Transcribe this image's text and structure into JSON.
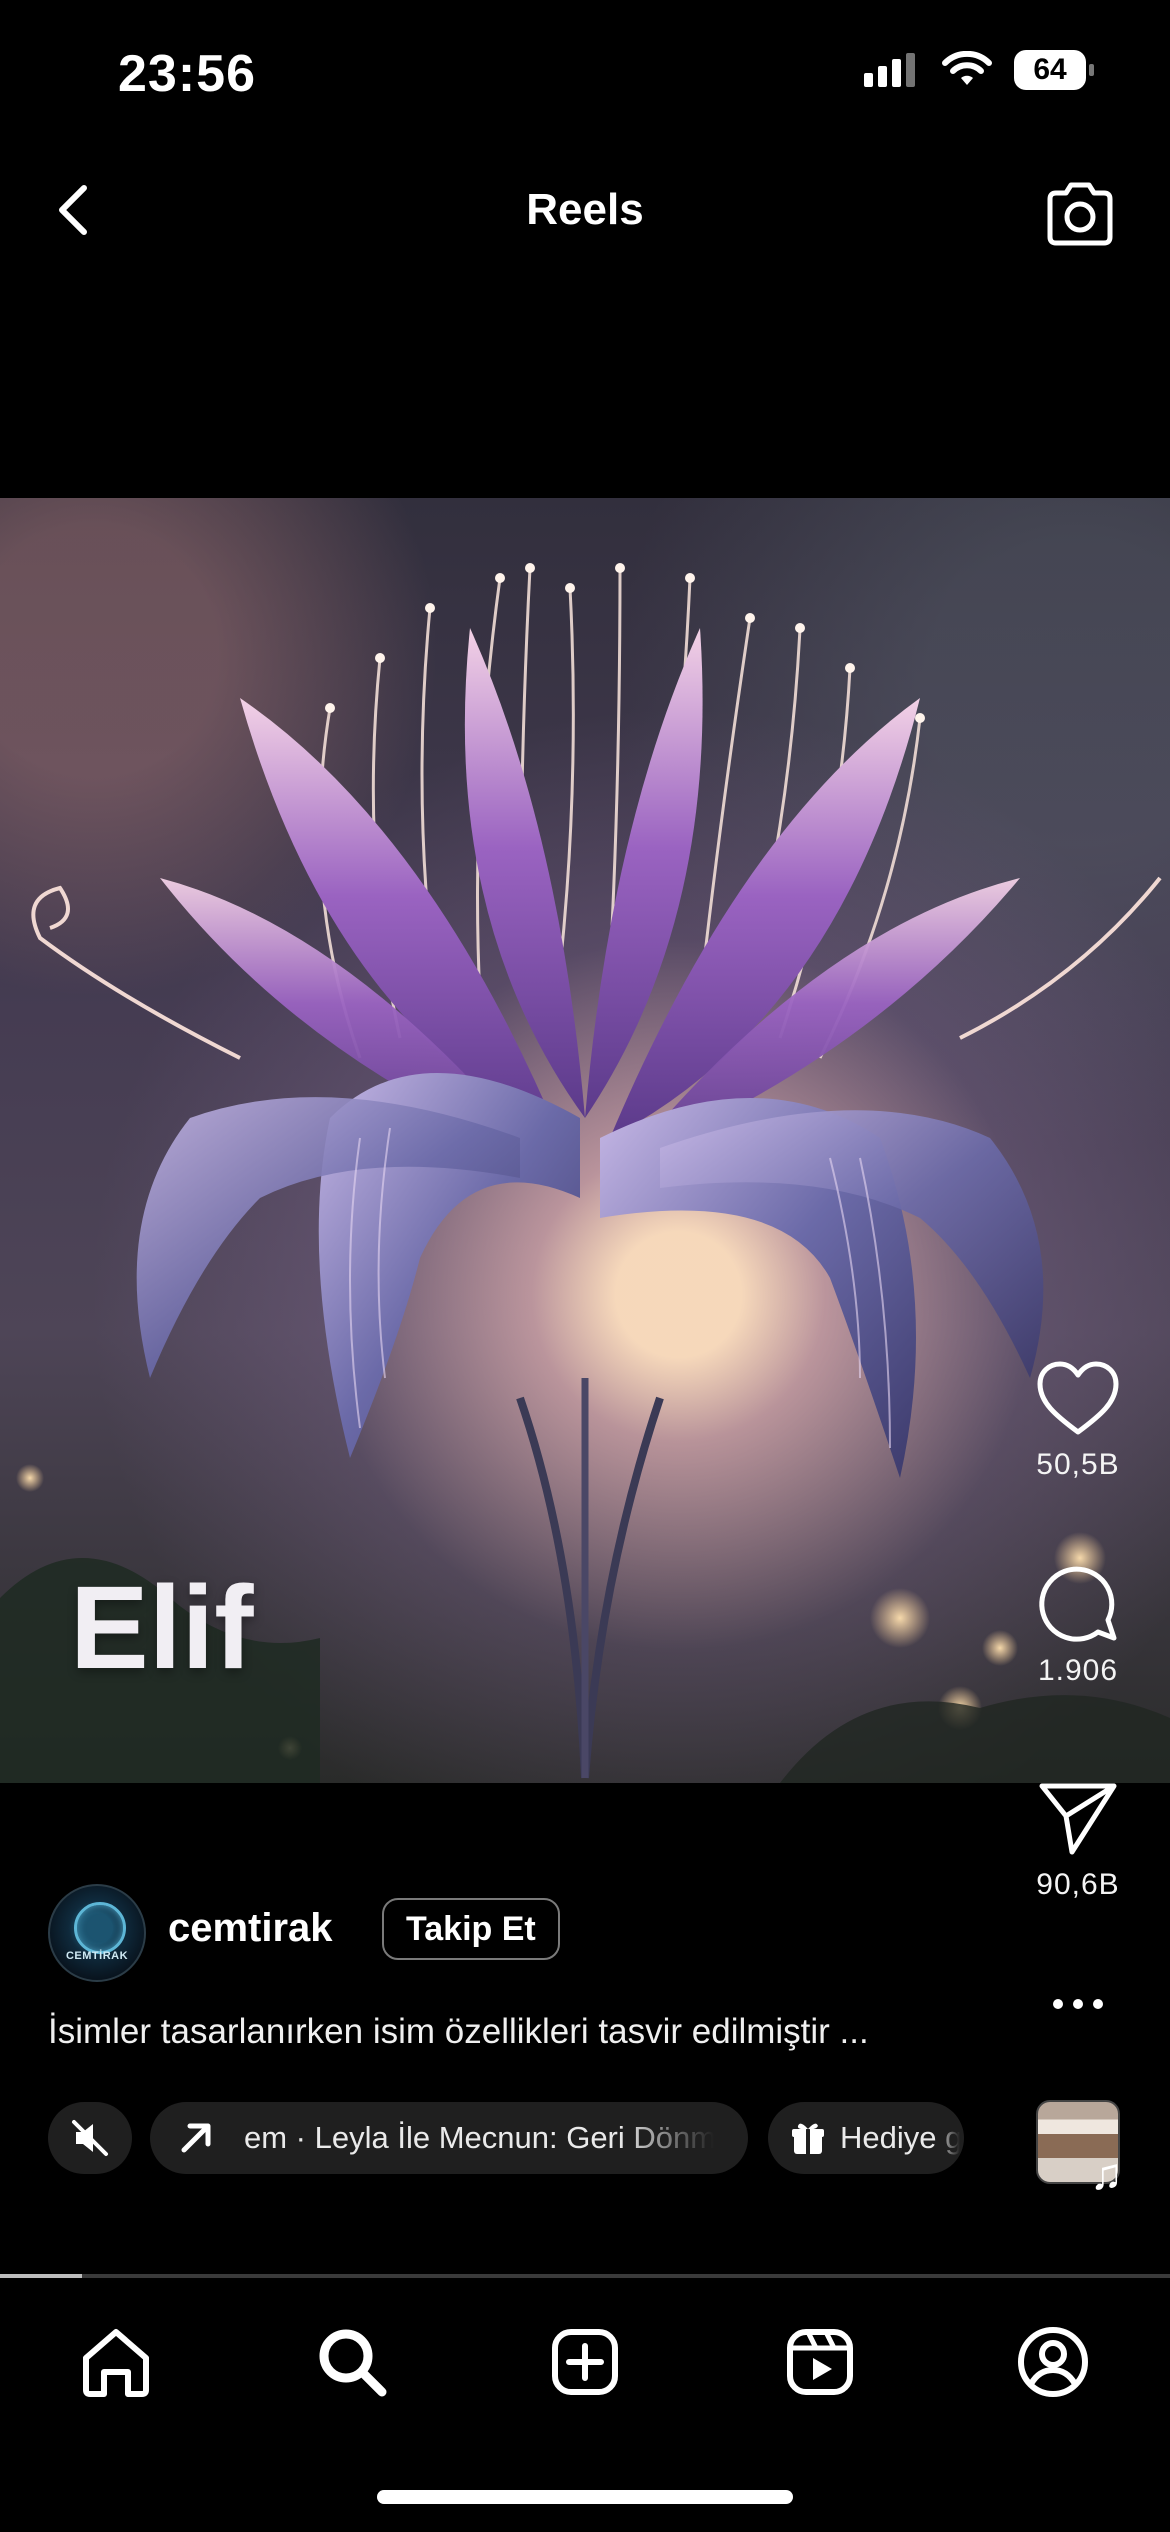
{
  "status_bar": {
    "time": "23:56",
    "battery": "64"
  },
  "header": {
    "title": "Reels"
  },
  "media": {
    "overlay_text": "Elif",
    "description": "Illustration of a purple fantasy lily with curling petals and glowing stamens on a bokeh background"
  },
  "actions": {
    "likes": "50,5B",
    "comments": "1.906",
    "shares": "90,6B"
  },
  "author": {
    "username": "cemtirak",
    "avatar_text": "CEMTİRAK",
    "follow_label": "Takip Et"
  },
  "caption": "İsimler tasarlanırken isim özellikleri tasvir edilmiştir ...",
  "chips": {
    "music": "em · Leyla İle Mecnun: Geri Dönme",
    "gift": "Hediye g"
  },
  "progress": {
    "fraction": 0.07
  },
  "tabs": [
    "home",
    "search",
    "create",
    "reels",
    "profile"
  ]
}
